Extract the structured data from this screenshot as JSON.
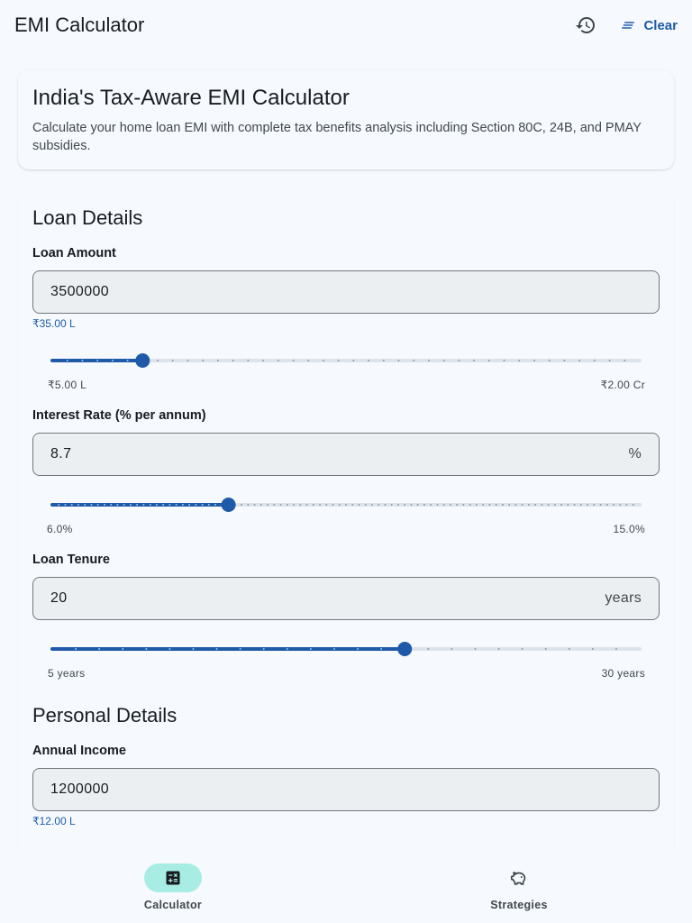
{
  "app": {
    "title": "EMI Calculator",
    "clear_label": "Clear",
    "history_icon": "history-icon",
    "clear_icon": "clear-all-icon"
  },
  "intro": {
    "title": "India's Tax-Aware EMI Calculator",
    "description": "Calculate your home loan EMI with complete tax benefits analysis including Section 80C, 24B, and PMAY subsidies."
  },
  "loan_details": {
    "title": "Loan Details",
    "loan_amount": {
      "label": "Loan Amount",
      "value": "3500000",
      "helper": "₹35.00 L",
      "min_label": "₹5.00 L",
      "max_label": "₹2.00 Cr",
      "slider_fraction": 0.1538,
      "slider_divisions": 39
    },
    "interest_rate": {
      "label": "Interest Rate (% per annum)",
      "value": "8.7",
      "suffix": "%",
      "min_label": "6.0%",
      "max_label": "15.0%",
      "slider_fraction": 0.3,
      "slider_divisions": 90
    },
    "tenure": {
      "label": "Loan Tenure",
      "value": "20",
      "suffix": "years",
      "min_label": "5 years",
      "max_label": "30 years",
      "slider_fraction": 0.6,
      "slider_divisions": 25
    }
  },
  "personal_details": {
    "title": "Personal Details",
    "annual_income": {
      "label": "Annual Income",
      "value": "1200000",
      "helper": "₹12.00 L"
    }
  },
  "nav": {
    "items": [
      {
        "label": "Calculator",
        "icon": "calculate-icon",
        "active": true
      },
      {
        "label": "Strategies",
        "icon": "savings-icon",
        "active": false
      }
    ]
  },
  "colors": {
    "primary": "#1e5aa8",
    "inactive_track": "#dde3ea",
    "nav_indicator": "#a7ede4",
    "background": "#f6fafe"
  }
}
